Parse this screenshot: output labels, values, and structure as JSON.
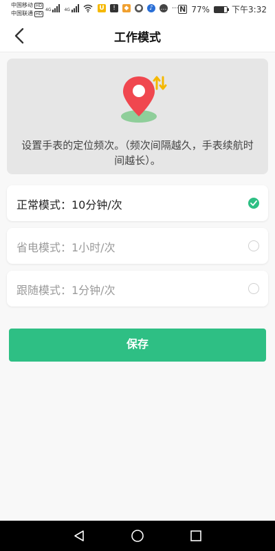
{
  "status_bar": {
    "carrier1": "中国移动",
    "carrier2": "中国联通",
    "hd": "HD",
    "net_tag": "4G",
    "battery_percent": "77%",
    "time": "下午3:32",
    "battery_level": 0.77
  },
  "header": {
    "title": "工作模式",
    "back_icon": "chevron-left-icon"
  },
  "info": {
    "icon": "location-pin-icon",
    "description": "设置手表的定位频次。（频次间隔越久，手表续航时间越长）。"
  },
  "modes": [
    {
      "label": "正常模式：10分钟/次",
      "selected": true
    },
    {
      "label": "省电模式：1小时/次",
      "selected": false
    },
    {
      "label": "跟随模式：1分钟/次",
      "selected": false
    }
  ],
  "save_label": "保存",
  "colors": {
    "accent": "#2ebf84",
    "pin_red": "#f0474f",
    "arrow_yellow": "#f5b800"
  },
  "nav": {
    "back": "triangle-back-icon",
    "home": "circle-home-icon",
    "recents": "square-recents-icon"
  }
}
